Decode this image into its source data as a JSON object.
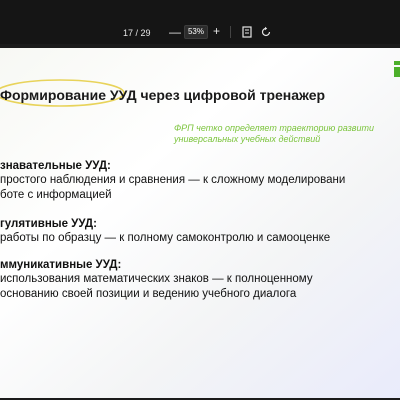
{
  "toolbar": {
    "page_counter": "17 / 29",
    "zoom_value": "53%",
    "zoom_out_symbol": "—",
    "zoom_in_symbol": "+",
    "icons": [
      "fit-page-icon",
      "rotate-icon"
    ]
  },
  "slide": {
    "title": "Формирование УУД через цифровой тренажер",
    "subtitle_line1": "ФРП четко определяет траекторию развити",
    "subtitle_line2": "универсальных учебных действий",
    "sections": [
      {
        "heading": "знавательные УУД:",
        "lines": [
          "простого наблюдения и сравнения — к сложному моделировани",
          "боте с информацией"
        ]
      },
      {
        "heading": "гулятивные УУД:",
        "lines": [
          "работы по образцу — к полному самоконтролю и самооценке"
        ]
      },
      {
        "heading": "ммуникативные УУД:",
        "lines": [
          "использования математических знаков — к полноценному",
          "основанию своей позиции и ведению учебного диалога"
        ]
      }
    ],
    "colors": {
      "accent_green": "#7cc43d",
      "highlight_ellipse": "#e8d35a",
      "logo_green": "#4caf2a"
    }
  }
}
